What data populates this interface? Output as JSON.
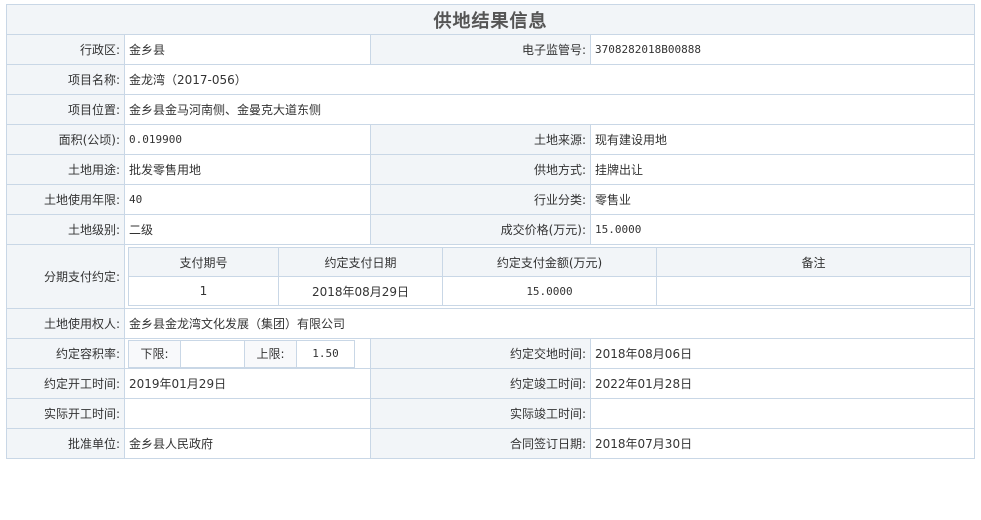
{
  "title": "供地结果信息",
  "rows": {
    "district_label": "行政区:",
    "district_value": "金乡县",
    "supervision_label": "电子监管号:",
    "supervision_value": "3708282018B00888",
    "project_name_label": "项目名称:",
    "project_name_value": "金龙湾（2017-056）",
    "project_location_label": "项目位置:",
    "project_location_value": "金乡县金马河南侧、金曼克大道东侧",
    "area_label": "面积(公顷):",
    "area_value": "0.019900",
    "land_source_label": "土地来源:",
    "land_source_value": "现有建设用地",
    "land_use_label": "土地用途:",
    "land_use_value": "批发零售用地",
    "supply_method_label": "供地方式:",
    "supply_method_value": "挂牌出让",
    "term_label": "土地使用年限:",
    "term_value": "40",
    "industry_label": "行业分类:",
    "industry_value": "零售业",
    "grade_label": "土地级别:",
    "grade_value": "二级",
    "price_label": "成交价格(万元):",
    "price_value": "15.0000",
    "installment_label": "分期支付约定:",
    "owner_label": "土地使用权人:",
    "owner_value": "金乡县金龙湾文化发展（集团）有限公司",
    "far_label": "约定容积率:",
    "far_lower_label": "下限:",
    "far_lower_value": "",
    "far_upper_label": "上限:",
    "far_upper_value": "1.50",
    "handover_label": "约定交地时间:",
    "handover_value": "2018年08月06日",
    "start_label": "约定开工时间:",
    "start_value": "2019年01月29日",
    "complete_label": "约定竣工时间:",
    "complete_value": "2022年01月28日",
    "actual_start_label": "实际开工时间:",
    "actual_start_value": "",
    "actual_complete_label": "实际竣工时间:",
    "actual_complete_value": "",
    "approver_label": "批准单位:",
    "approver_value": "金乡县人民政府",
    "contract_date_label": "合同签订日期:",
    "contract_date_value": "2018年07月30日"
  },
  "installments": {
    "headers": [
      "支付期号",
      "约定支付日期",
      "约定支付金额(万元)",
      "备注"
    ],
    "rows": [
      [
        "1",
        "2018年08月29日",
        "15.0000",
        ""
      ]
    ]
  }
}
